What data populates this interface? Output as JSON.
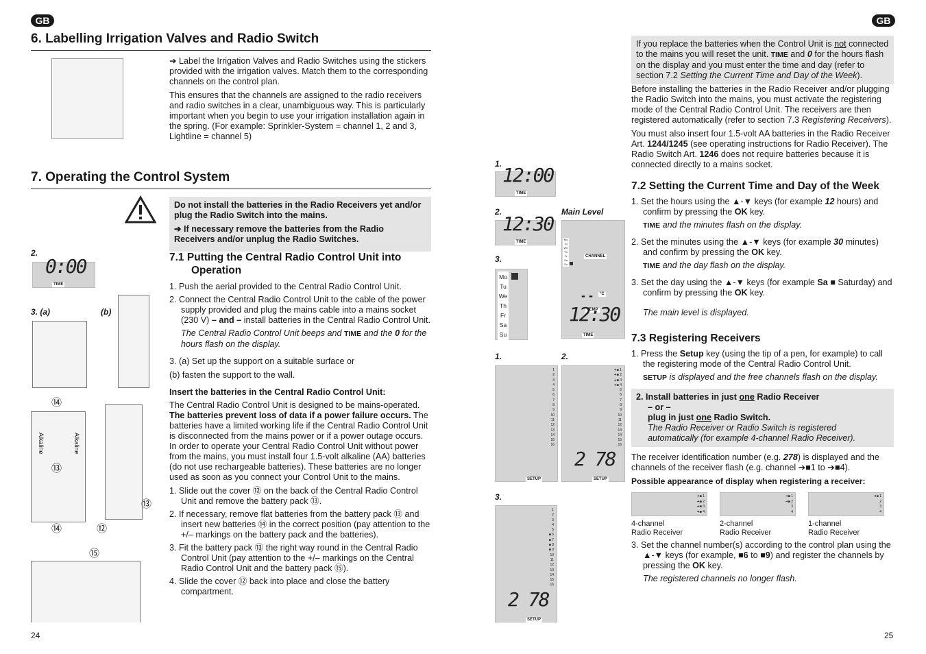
{
  "badge": "GB",
  "left": {
    "s6_title": "6. Labelling Irrigation Valves and Radio Switch",
    "s6_paras": [
      [
        {
          "t": "➔ Label the Irrigation Valves and Radio Switches using the stickers provided with the irrigation valves. Match them to the corresponding channels on the control plan."
        }
      ],
      [
        {
          "t": "This ensures that the channels are assigned to the radio receivers and radio switches in a clear, unambiguous way. This is particularly important when you begin to use your irrigation installation again in the spring. (For example: Sprinkler-System = channel 1, 2 and 3, Lightline = channel 5)"
        }
      ]
    ],
    "s7_title": "7. Operating the Control System",
    "warning": [
      [
        {
          "t": "Do not install the batteries in the Radio Receivers yet and/or plug the Radio Switch into the mains.",
          "b": 1
        }
      ],
      [
        {
          "t": "➔ If necessary remove the batteries from the Radio Receivers and/or unplug the Radio Switches.",
          "b": 1
        }
      ]
    ],
    "s71_title": "7.1  Putting the Central Radio Control Unit into Operation",
    "s71_items": [
      [
        {
          "t": "1. Push the aerial provided to the Central Radio Control Unit."
        }
      ],
      [
        {
          "t": "2. Connect the Central Radio Control Unit to the cable of the power supply provided and plug the mains cable into a mains socket (230 V) "
        },
        {
          "t": "– and –",
          "b": 1
        },
        {
          "t": " install batteries in the Central Radio Control Unit."
        }
      ]
    ],
    "s71_note": [
      {
        "t": "The Central Radio Control Unit beeps and ",
        "i": 1
      },
      {
        "t": "TIME",
        "b": 1
      },
      {
        "t": " and the ",
        "i": 1
      },
      {
        "t": "0",
        "b": 1,
        "i": 1
      },
      {
        "t": " for the hours flash on the display.",
        "i": 1
      }
    ],
    "s71_item3": [
      [
        {
          "t": "3. (a)  Set up the support on a suitable surface or"
        }
      ],
      [
        {
          "t": "    (b)  fasten the support to the wall."
        }
      ]
    ],
    "batt_heading": "Insert the batteries in the Central Radio Control Unit:",
    "batt_para": [
      {
        "t": "The Central Radio Control Unit is designed to be mains-operated. "
      },
      {
        "t": "The batteries prevent loss of data if a power failure occurs.",
        "b": 1
      },
      {
        "t": " The batteries have a limited working life if the Central Radio Control Unit is disconnected from the mains power or if a power outage occurs. In order to operate your Central Radio Control Unit without power from the mains, you must install four 1.5-volt alkaline (AA) batteries (do not use rechargeable batteries). These batteries are no longer used as soon as you connect your Control Unit to the mains."
      }
    ],
    "batt_items": [
      [
        {
          "t": "1. Slide out the cover ⑫ on the back of the Central Radio Control Unit and remove the battery pack ⑬."
        }
      ],
      [
        {
          "t": "2. If necessary, remove flat batteries from the battery pack ⑬ and insert new batteries ⑭ in the correct position (pay attention to the +/– markings on the battery pack and the batteries)."
        }
      ],
      [
        {
          "t": "3. Fit the battery pack ⑬ the right way round in the Central Radio Control Unit (pay attention to the +/– markings on the Central Radio Control Unit and the battery pack ⑮)."
        }
      ],
      [
        {
          "t": "4. Slide the cover ⑫ back into place and close the battery compartment."
        }
      ]
    ],
    "fig_labels": {
      "two": "2.",
      "three_a": "3. (a)",
      "b": "(b)",
      "n14a": "⑭",
      "n13a": "⑬",
      "n14b": "⑭",
      "n12": "⑫",
      "n13b": "⑬",
      "n15": "⑮",
      "alkaline": "Alkaline"
    },
    "lcd_0": "0:00",
    "lcd_time": "TIME",
    "page": "24"
  },
  "middle": {
    "l1": "1.",
    "l2": "2.",
    "main_level": "Main Level",
    "l3": "3.",
    "lcd1": "12:00",
    "lcd2": "12:30",
    "time": "TIME",
    "days": [
      "Mo",
      "Tu",
      "We",
      "Th",
      "Fr",
      "Sa",
      "Su"
    ],
    "channel": "CHANNEL",
    "deg": "°C",
    "dashes": "- -",
    "temp": "TEMP",
    "lcd_main": "12:30",
    "r1": "1.",
    "r2": "2.",
    "r3": "3.",
    "setup": "SETUP",
    "id": "2 78",
    "channels": [
      "1",
      "2",
      "3",
      "4",
      "5",
      "6",
      "7",
      "8",
      "9",
      "10",
      "11",
      "12",
      "13",
      "14",
      "15",
      "16"
    ]
  },
  "right": {
    "note": [
      {
        "t": "If you replace the batteries when the Control Unit is "
      },
      {
        "t": "not",
        "u": 1
      },
      {
        "t": " connected to the mains you will reset the unit. "
      },
      {
        "t": "TIME",
        "b": 1
      },
      {
        "t": " and "
      },
      {
        "t": "0",
        "b": 1,
        "i": 1
      },
      {
        "t": " for the hours flash on the display and you must enter the time and day (refer to section 7.2 "
      },
      {
        "t": "Setting the Current Time and Day of the Week",
        "i": 1
      },
      {
        "t": ")."
      }
    ],
    "p1": [
      {
        "t": "Before installing the batteries in the Radio Receiver and/or plugging the Radio Switch into the mains, you must activate the registering mode of the Central Radio Control Unit. The receivers are then registered automatically (refer to section 7.3 "
      },
      {
        "t": "Registering Receivers",
        "i": 1
      },
      {
        "t": ")."
      }
    ],
    "p2": [
      {
        "t": "You must also insert four 1.5-volt AA batteries in the Radio Receiver Art. "
      },
      {
        "t": "1244/1245",
        "b": 1
      },
      {
        "t": " (see operating instructions for Radio Receiver). The Radio Switch Art. "
      },
      {
        "t": "1246",
        "b": 1
      },
      {
        "t": " does not require batteries because it is connected directly to a mains socket."
      }
    ],
    "s72_title": "7.2  Setting the Current Time and Day of the Week",
    "s72_items": [
      [
        {
          "t": "1. Set the hours using the ▲-▼ keys (for example "
        },
        {
          "t": "12",
          "b": 1,
          "i": 1
        },
        {
          "t": " hours) and confirm by pressing the "
        },
        {
          "t": "OK",
          "b": 1
        },
        {
          "t": " key."
        }
      ],
      [
        {
          "t": "TIME",
          "b": 1
        },
        {
          "t": " and the minutes flash on the display.",
          "i": 1
        }
      ],
      [
        {
          "t": "2. Set the minutes using the ▲-▼ keys (for example "
        },
        {
          "t": "30",
          "b": 1,
          "i": 1
        },
        {
          "t": " minutes) and confirm by pressing the "
        },
        {
          "t": "OK",
          "b": 1
        },
        {
          "t": " key."
        }
      ],
      [
        {
          "t": "TIME",
          "b": 1
        },
        {
          "t": " and the day flash on the display.",
          "i": 1
        }
      ],
      [
        {
          "t": "3. Set the day using the ▲-▼ keys (for example "
        },
        {
          "t": "Sa ■",
          "b": 1
        },
        {
          "t": " Saturday) and confirm by pressing the "
        },
        {
          "t": "OK",
          "b": 1
        },
        {
          "t": " key."
        }
      ],
      [
        {
          "t": "The main level is displayed.",
          "i": 1
        }
      ]
    ],
    "s73_title": "7.3  Registering Receivers",
    "s73_item1": [
      {
        "t": "1. Press the "
      },
      {
        "t": "Setup",
        "b": 1
      },
      {
        "t": " key (using the tip of a pen, for example) to call the registering mode of the Central Radio Control Unit."
      }
    ],
    "s73_note1": [
      {
        "t": "SETUP",
        "b": 1
      },
      {
        "t": " is displayed and the free channels flash on the display.",
        "i": 1
      }
    ],
    "box2": [
      {
        "t": "2. Install batteries in just ",
        "b": 1
      },
      {
        "t": "one",
        "b": 1,
        "u": 1
      },
      {
        "t": " Radio Receiver",
        "b": 1
      }
    ],
    "box2_or": "– or –",
    "box2_b": [
      {
        "t": "plug in just ",
        "b": 1
      },
      {
        "t": "one",
        "b": 1,
        "u": 1
      },
      {
        "t": " Radio Switch.",
        "b": 1
      }
    ],
    "box2_note": "The Radio Receiver or Radio Switch is registered automatically (for example 4-channel Radio Receiver).",
    "p3": [
      {
        "t": "The receiver identification number (e.g. "
      },
      {
        "t": "278",
        "b": 1,
        "i": 1
      },
      {
        "t": ") is displayed and the channels of the receiver flash (e.g. channel ➔■1 to ➔■4)."
      }
    ],
    "possible": "Possible appearance of display when registering a receiver:",
    "receivers": [
      {
        "label": "4-channel\nRadio Receiver",
        "n": 4
      },
      {
        "label": "2-channel\nRadio Receiver",
        "n": 2
      },
      {
        "label": "1-channel\nRadio Receiver",
        "n": 1
      }
    ],
    "s73_item3": [
      {
        "t": "3. Set the channel number(s) according to the control plan using the ▲-▼ keys (for example, "
      },
      {
        "t": "■6",
        "b": 1
      },
      {
        "t": " to "
      },
      {
        "t": "■9",
        "b": 1
      },
      {
        "t": ") and register the channels by pressing the "
      },
      {
        "t": "OK",
        "b": 1
      },
      {
        "t": " key."
      }
    ],
    "s73_note3": "The registered channels no longer flash.",
    "page": "25"
  }
}
